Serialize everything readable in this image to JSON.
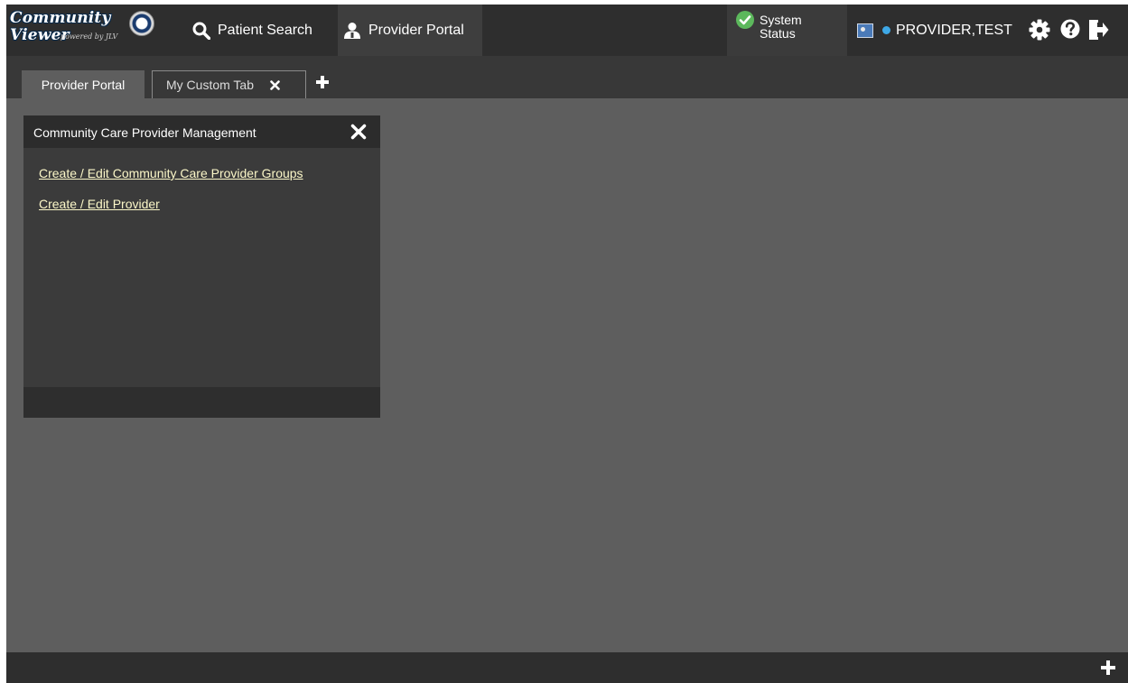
{
  "header": {
    "logo": {
      "line1": "Community",
      "line2": "Viewer",
      "powered_by": "powered by JLV"
    },
    "nav": [
      {
        "label": "Patient Search",
        "icon": "search-icon"
      },
      {
        "label": "Provider Portal",
        "icon": "provider-icon"
      }
    ],
    "system_status": {
      "line1": "System",
      "line2": "Status",
      "icon": "check-circle-icon",
      "color": "#5cb85c"
    },
    "user": {
      "name": "PROVIDER,TEST",
      "status_color": "#3ea8e6"
    },
    "icons": [
      "gear-icon",
      "help-icon",
      "logout-icon"
    ]
  },
  "tabs": [
    {
      "label": "Provider Portal",
      "active": true
    },
    {
      "label": "My Custom Tab",
      "active": false
    }
  ],
  "widget": {
    "title": "Community Care Provider Management",
    "links": [
      "Create / Edit Community Care Provider Groups",
      "Create / Edit Provider"
    ]
  }
}
